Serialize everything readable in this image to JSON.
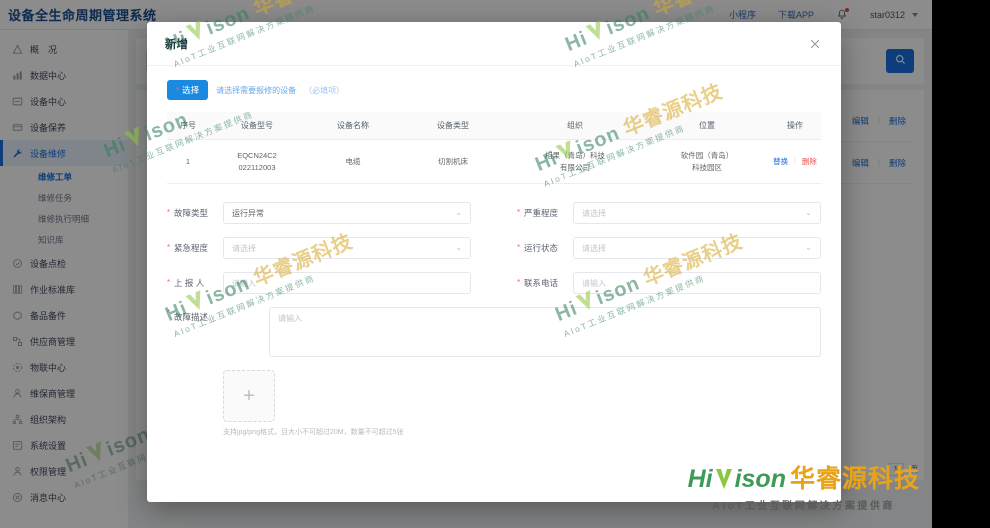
{
  "brand": {
    "title": "设备全生命周期管理系统"
  },
  "topnav": {
    "items": [
      {
        "label": "小程序",
        "icon": "miniprogram-link"
      },
      {
        "label": "下载APP",
        "icon": "download-app-link"
      }
    ],
    "notification_icon": "bell-icon",
    "user": "star0312",
    "user_caret": "chevron-down-icon"
  },
  "sidebar": {
    "items": [
      {
        "label": "概　况",
        "icon": "dashboard-icon",
        "active": false
      },
      {
        "label": "数据中心",
        "icon": "data-center-icon",
        "active": false
      },
      {
        "label": "设备中心",
        "icon": "device-center-icon",
        "active": false
      },
      {
        "label": "设备保养",
        "icon": "maintenance-icon",
        "active": false
      },
      {
        "label": "设备维修",
        "icon": "repair-icon",
        "active": true
      },
      {
        "label": "设备点检",
        "icon": "inspection-icon",
        "active": false
      },
      {
        "label": "作业标准库",
        "icon": "standard-library-icon",
        "active": false
      },
      {
        "label": "备品备件",
        "icon": "spare-parts-icon",
        "active": false
      },
      {
        "label": "供应商管理",
        "icon": "supplier-icon",
        "active": false
      },
      {
        "label": "物联中心",
        "icon": "iot-center-icon",
        "active": false
      },
      {
        "label": "维保商管理",
        "icon": "service-provider-icon",
        "active": false
      },
      {
        "label": "组织架构",
        "icon": "org-structure-icon",
        "active": false
      },
      {
        "label": "系统设置",
        "icon": "settings-icon",
        "active": false
      },
      {
        "label": "权限管理",
        "icon": "permission-icon",
        "active": false
      },
      {
        "label": "消息中心",
        "icon": "message-center-icon",
        "active": false
      }
    ],
    "sub_items": [
      {
        "label": "维修工单",
        "active": true
      },
      {
        "label": "维修任务",
        "active": false
      },
      {
        "label": "维修执行明细",
        "active": false
      },
      {
        "label": "知识库",
        "active": false
      }
    ]
  },
  "background": {
    "search_icon": "search-icon",
    "rows": [
      {
        "edit": "编辑",
        "delete": "删除"
      },
      {
        "edit": "编辑",
        "delete": "删除"
      }
    ],
    "pager": {
      "page": "1",
      "unit": "页"
    }
  },
  "modal": {
    "title": "新增",
    "close_icon": "close-icon",
    "select_button": {
      "label": "选择",
      "star": "*"
    },
    "select_hint": "请选择需要报修的设备",
    "select_hint_sub": "（必填项）",
    "table": {
      "headers": [
        "序号",
        "设备型号",
        "设备名称",
        "设备类型",
        "组织",
        "位置",
        "操作"
      ],
      "rows": [
        {
          "index": "1",
          "model_line1": "EQCN24C2",
          "model_line2": "022112003",
          "name": "电缆",
          "type": "切割机床",
          "org_line1": "相果（青岛）科技",
          "org_line2": "有限公司",
          "location_line1": "软件园（青岛）",
          "location_line2": "科技园区",
          "action_replace": "替换",
          "action_delete": "删除"
        }
      ]
    },
    "form": {
      "rows": [
        {
          "left": {
            "label": "故障类型",
            "required": true,
            "value": "运行异常",
            "is_placeholder": false,
            "type": "select"
          },
          "right": {
            "label": "严重程度",
            "required": true,
            "value": "请选择",
            "is_placeholder": true,
            "type": "select"
          }
        },
        {
          "left": {
            "label": "紧急程度",
            "required": true,
            "value": "请选择",
            "is_placeholder": true,
            "type": "select"
          },
          "right": {
            "label": "运行状态",
            "required": true,
            "value": "请选择",
            "is_placeholder": true,
            "type": "select"
          }
        },
        {
          "left": {
            "label": "上 报 人",
            "required": true,
            "value": "请输入",
            "is_placeholder": true,
            "type": "input"
          },
          "right": {
            "label": "联系电话",
            "required": true,
            "value": "请输入",
            "is_placeholder": true,
            "type": "input"
          }
        }
      ],
      "description": {
        "label": "故障描述",
        "required": true,
        "placeholder": "请输入"
      },
      "upload": {
        "plus": "+",
        "hint": "支持jpg/png格式，且大小不可超过20M，数量不可超过5张"
      }
    }
  },
  "watermark": {
    "brand_hi": "Hi",
    "brand_ison": "ison",
    "brand_cn": "华睿源科技",
    "tagline": "AIoT工业互联网解决方案提供商"
  },
  "logo": {
    "hi": "Hi",
    "ison": "ison",
    "cn": "华睿源科技",
    "tagline": "AIoT工业互联网解决方案提供商"
  },
  "colors": {
    "accent": "#1a6fe0",
    "brand_green": "#3e9b57",
    "brand_gold": "#e8a317",
    "danger": "#e8504a",
    "required": "#f56c6c"
  }
}
